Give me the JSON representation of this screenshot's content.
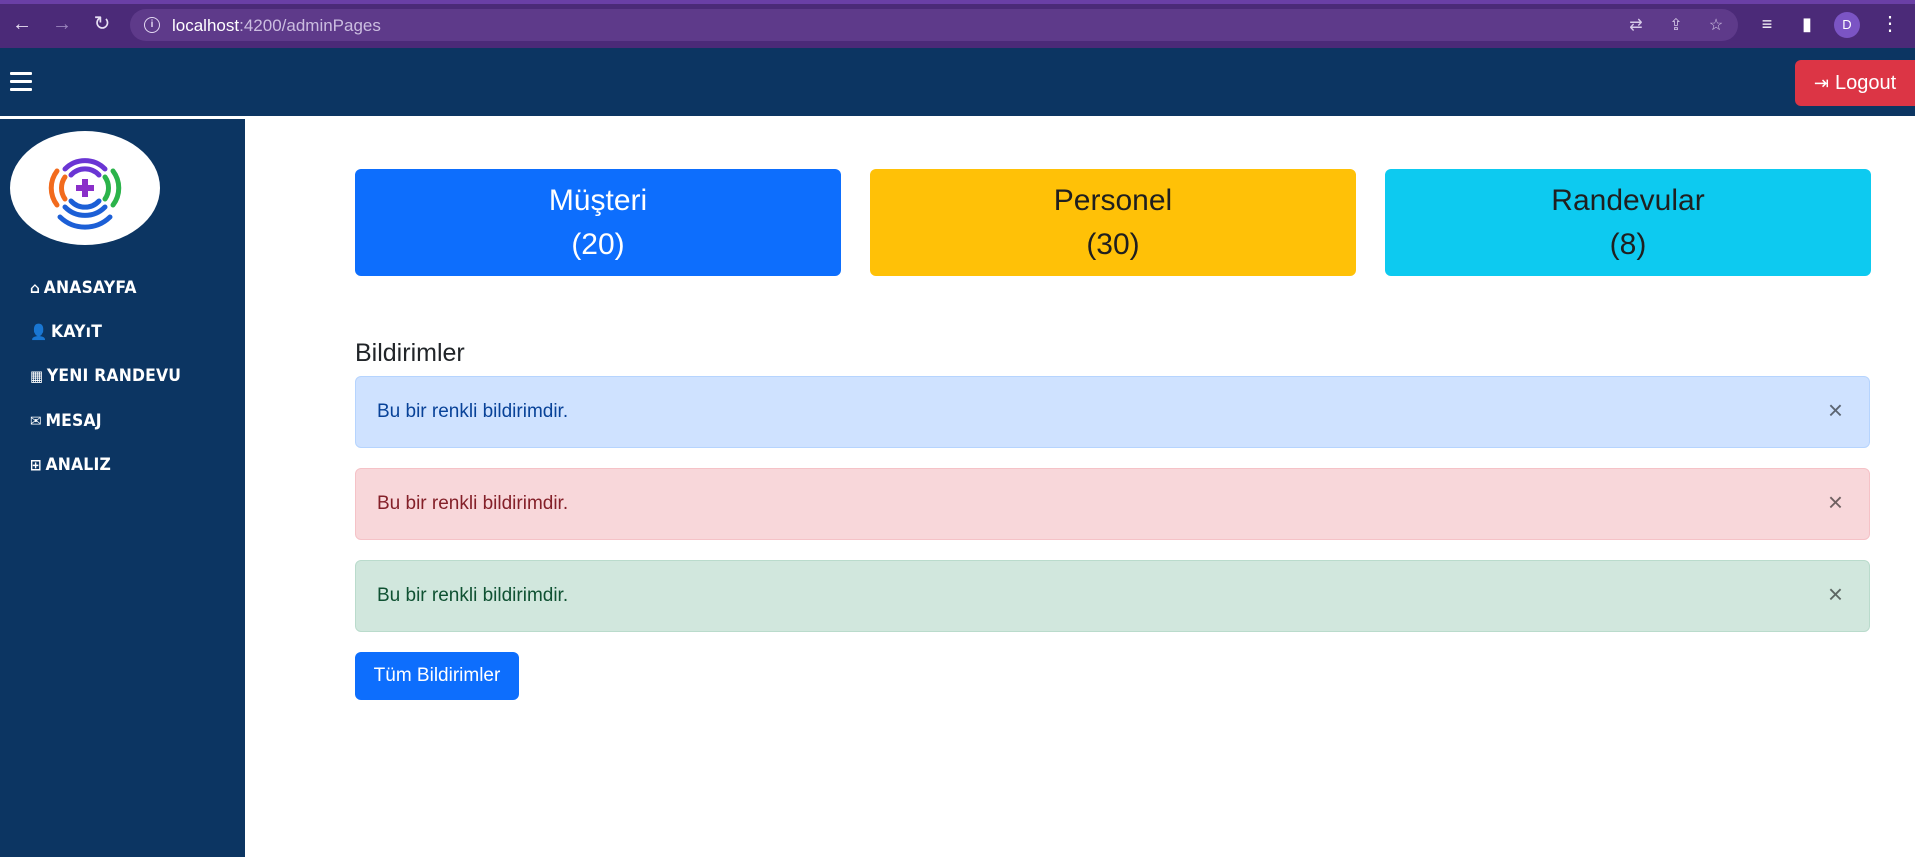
{
  "browser": {
    "url_host": "localhost",
    "url_path": ":4200/adminPages",
    "profile_initial": "D",
    "back_icon": "←",
    "forward_icon": "→",
    "reload_icon": "↻",
    "info_icon": "i",
    "translate_icon": "⇄",
    "share_icon": "⇪",
    "star_icon": "☆",
    "media_icon": "≡",
    "sidepanel_icon": "▮",
    "menu_icon": "⋮"
  },
  "navbar": {
    "logout_label": "Logout",
    "logout_icon": "⇥",
    "accent_color": "#0c3562",
    "logout_color": "#dc3545"
  },
  "sidebar": {
    "items": [
      {
        "icon": "⌂",
        "label": "ANASAYFA"
      },
      {
        "icon": "👤",
        "label": "KAYıT"
      },
      {
        "icon": "▦",
        "label": "YENI RANDEVU"
      },
      {
        "icon": "✉",
        "label": "MESAJ"
      },
      {
        "icon": "⊞",
        "label": "ANALIZ"
      }
    ]
  },
  "cards": [
    {
      "title": "Müşteri",
      "count": "(20)",
      "color": "#0d6efd"
    },
    {
      "title": "Personel",
      "count": "(30)",
      "color": "#ffc107"
    },
    {
      "title": "Randevular",
      "count": "(8)",
      "color": "#0dcaf0"
    }
  ],
  "notifications": {
    "title": "Bildirimler",
    "items": [
      {
        "text": "Bu bir renkli bildirimdir.",
        "variant": "primary"
      },
      {
        "text": "Bu bir renkli bildirimdir.",
        "variant": "danger"
      },
      {
        "text": "Bu bir renkli bildirimdir.",
        "variant": "success"
      }
    ],
    "close_icon": "×",
    "all_button_label": "Tüm Bildirimler"
  }
}
